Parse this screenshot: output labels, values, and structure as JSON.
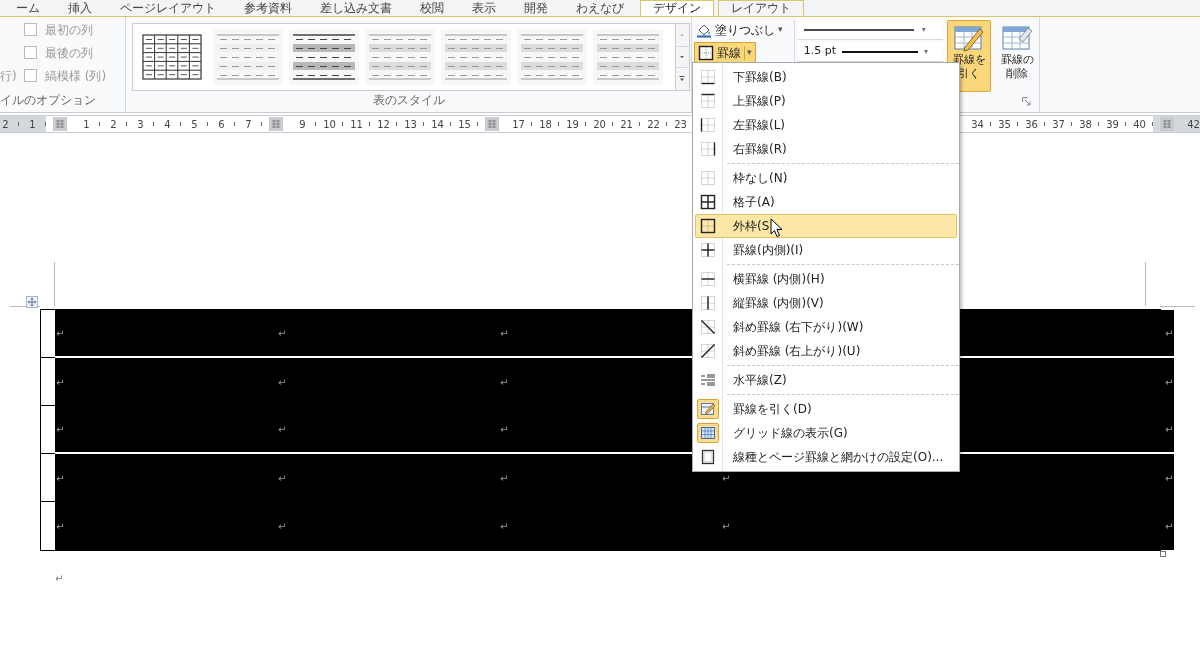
{
  "ribbon_tabs": [
    {
      "label": "ーム",
      "selected": false,
      "contextual": false
    },
    {
      "label": "挿入",
      "selected": false,
      "contextual": false
    },
    {
      "label": "ページレイアウト",
      "selected": false,
      "contextual": false
    },
    {
      "label": "参考資料",
      "selected": false,
      "contextual": false
    },
    {
      "label": "差し込み文書",
      "selected": false,
      "contextual": false
    },
    {
      "label": "校閲",
      "selected": false,
      "contextual": false
    },
    {
      "label": "表示",
      "selected": false,
      "contextual": false
    },
    {
      "label": "開発",
      "selected": false,
      "contextual": false
    },
    {
      "label": "わえなび",
      "selected": false,
      "contextual": false
    },
    {
      "label": "デザイン",
      "selected": true,
      "contextual": true
    },
    {
      "label": "レイアウト",
      "selected": false,
      "contextual": true
    }
  ],
  "options_group": {
    "cut_label": "行)",
    "label": "イルのオプション",
    "checkboxes": [
      {
        "label": "最初の列",
        "checked": false
      },
      {
        "label": "最後の列",
        "checked": false
      },
      {
        "label": "縞模様 (列)",
        "checked": false
      }
    ]
  },
  "styles_group": {
    "label": "表のスタイル",
    "thumbnails": [
      {
        "kind": "grid"
      },
      {
        "kind": "plain"
      },
      {
        "kind": "banded_dark"
      },
      {
        "kind": "banded"
      },
      {
        "kind": "banded"
      },
      {
        "kind": "banded"
      },
      {
        "kind": "banded"
      }
    ]
  },
  "borders_group": {
    "shading": {
      "label": "塗りつぶし",
      "caret": "▾"
    },
    "borders": {
      "label": "罫線",
      "caret": "▾",
      "on": true
    },
    "line_style": {
      "caret": "▾"
    },
    "line_weight": {
      "value": "1.5 pt",
      "caret": "▾"
    },
    "draw_table": {
      "label": "罫線を引く",
      "on": true
    },
    "eraser": {
      "label": "罫線の削除",
      "on": false
    }
  },
  "ruler": [
    {
      "kind": "margin_number",
      "label": "2"
    },
    {
      "kind": "margin_number",
      "label": "1"
    },
    {
      "kind": "marker"
    },
    {
      "kind": "number",
      "label": "1"
    },
    {
      "kind": "number",
      "label": "2"
    },
    {
      "kind": "number",
      "label": "3"
    },
    {
      "kind": "number",
      "label": "4"
    },
    {
      "kind": "number",
      "label": "5"
    },
    {
      "kind": "number",
      "label": "6"
    },
    {
      "kind": "number",
      "label": "7"
    },
    {
      "kind": "marker"
    },
    {
      "kind": "number",
      "label": "9"
    },
    {
      "kind": "number",
      "label": "10"
    },
    {
      "kind": "number",
      "label": "11"
    },
    {
      "kind": "number",
      "label": "12"
    },
    {
      "kind": "number",
      "label": "13"
    },
    {
      "kind": "number",
      "label": "14"
    },
    {
      "kind": "number",
      "label": "15"
    },
    {
      "kind": "marker"
    },
    {
      "kind": "number",
      "label": "17"
    },
    {
      "kind": "number",
      "label": "18"
    },
    {
      "kind": "number",
      "label": "19"
    },
    {
      "kind": "number",
      "label": "20"
    },
    {
      "kind": "number",
      "label": "21"
    },
    {
      "kind": "number",
      "label": "22"
    },
    {
      "kind": "number",
      "label": "23"
    },
    {
      "kind": "gap"
    },
    {
      "kind": "gap"
    },
    {
      "kind": "gap"
    },
    {
      "kind": "gap"
    },
    {
      "kind": "gap"
    },
    {
      "kind": "gap"
    },
    {
      "kind": "gap"
    },
    {
      "kind": "gap"
    },
    {
      "kind": "gap"
    },
    {
      "kind": "gap"
    },
    {
      "kind": "number",
      "label": "34"
    },
    {
      "kind": "number",
      "label": "35"
    },
    {
      "kind": "number",
      "label": "36"
    },
    {
      "kind": "number",
      "label": "37"
    },
    {
      "kind": "number",
      "label": "38"
    },
    {
      "kind": "number",
      "label": "39"
    },
    {
      "kind": "number",
      "label": "40"
    },
    {
      "kind": "margin_marker"
    },
    {
      "kind": "margin_number",
      "label": "42"
    }
  ],
  "table": {
    "rows": [
      {
        "rule_below": true,
        "cells": [
          {
            "mark": "↵"
          },
          {
            "mark": "↵"
          },
          {
            "mark": "↵"
          },
          {},
          {}
        ],
        "end_mark": "↵"
      },
      {
        "rule_below": false,
        "cells": [
          {
            "mark": "↵"
          },
          {
            "mark": "↵"
          },
          {
            "mark": "↵"
          },
          {},
          {}
        ],
        "end_mark": "↵"
      },
      {
        "rule_below": true,
        "cells": [
          {
            "mark": "↵"
          },
          {
            "mark": "↵"
          },
          {
            "mark": "↵"
          },
          {},
          {}
        ],
        "end_mark": "↵"
      },
      {
        "rule_below": false,
        "cells": [
          {
            "mark": "↵"
          },
          {
            "mark": "↵"
          },
          {
            "mark": "↵"
          },
          {
            "mark": "↵"
          },
          {}
        ],
        "end_mark": "↵"
      },
      {
        "rule_below": false,
        "cells": [
          {
            "mark": "↵"
          },
          {
            "mark": "↵"
          },
          {
            "mark": "↵"
          },
          {
            "mark": "↵"
          },
          {}
        ],
        "end_mark": "↵"
      }
    ]
  },
  "paragraph_mark": "↵",
  "border_menu": [
    {
      "kind": "bottom",
      "separator_above": false,
      "label": "下罫線(B)",
      "selected": false,
      "on": false
    },
    {
      "kind": "top",
      "separator_above": false,
      "label": "上罫線(P)",
      "selected": false,
      "on": false
    },
    {
      "kind": "left",
      "separator_above": false,
      "label": "左罫線(L)",
      "selected": false,
      "on": false
    },
    {
      "kind": "right",
      "separator_above": false,
      "label": "右罫線(R)",
      "selected": false,
      "on": false
    },
    {
      "kind": "none",
      "separator_above": true,
      "label": "枠なし(N)",
      "selected": false,
      "on": false
    },
    {
      "kind": "all",
      "separator_above": false,
      "label": "格子(A)",
      "selected": false,
      "on": false
    },
    {
      "kind": "outside",
      "separator_above": false,
      "label": "外枠(S",
      "selected": true,
      "on": false
    },
    {
      "kind": "inside",
      "separator_above": false,
      "label": "罫線(内側)(I)",
      "selected": false,
      "on": false
    },
    {
      "kind": "inside_h",
      "separator_above": true,
      "label": "横罫線 (内側)(H)",
      "selected": false,
      "on": false
    },
    {
      "kind": "inside_v",
      "separator_above": false,
      "label": "縦罫線 (内側)(V)",
      "selected": false,
      "on": false
    },
    {
      "kind": "diag_down",
      "separator_above": false,
      "label": "斜め罫線 (右下がり)(W)",
      "selected": false,
      "on": false
    },
    {
      "kind": "diag_up",
      "separator_above": false,
      "label": "斜め罫線 (右上がり)(U)",
      "selected": false,
      "on": false
    },
    {
      "kind": "hline",
      "separator_above": true,
      "label": "水平線(Z)",
      "selected": false,
      "on": false
    },
    {
      "kind": "draw",
      "separator_above": true,
      "label": "罫線を引く(D)",
      "selected": false,
      "on": true
    },
    {
      "kind": "grid",
      "separator_above": false,
      "label": "グリッド線の表示(G)",
      "selected": false,
      "on": true
    },
    {
      "kind": "dialog",
      "separator_above": false,
      "label": "線種とページ罫線と網かけの設定(O)...",
      "selected": false,
      "on": false
    }
  ]
}
